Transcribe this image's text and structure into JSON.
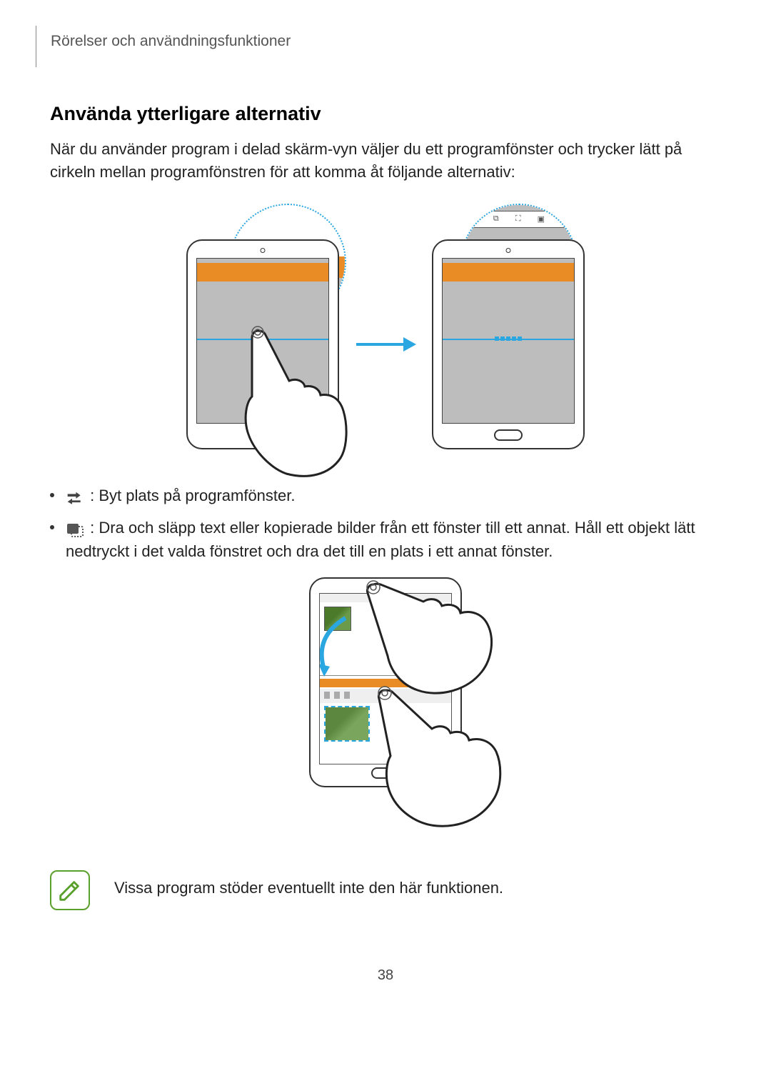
{
  "header": "Rörelser och användningsfunktioner",
  "subheading": "Använda ytterligare alternativ",
  "intro": "När du använder program i delad skärm-vyn väljer du ett programfönster och trycker lätt på cirkeln mellan programfönstren för att komma åt följande alternativ:",
  "bullets": {
    "swap": ": Byt plats på programfönster.",
    "drag": ": Dra och släpp text eller kopierade bilder från ett fönster till ett annat. Håll ett objekt lätt nedtryckt i det valda fönstret och dra det till en plats i ett annat fönster."
  },
  "note": "Vissa program stöder eventuellt inte den här funktionen.",
  "page_number": "38"
}
